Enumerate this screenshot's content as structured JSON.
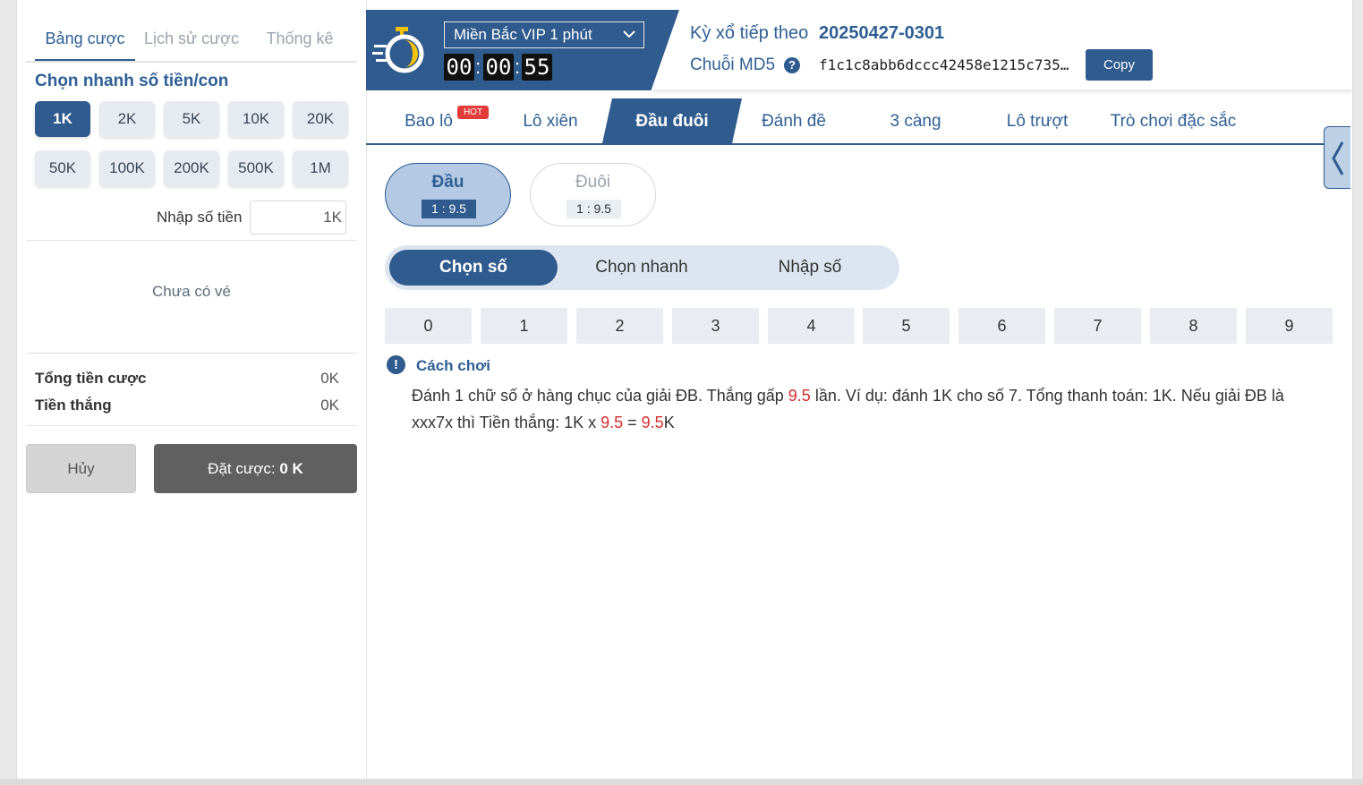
{
  "left_tabs": [
    {
      "label": "Bảng cược"
    },
    {
      "label": "Lịch sử cược"
    },
    {
      "label": "Thống kê"
    }
  ],
  "quick_amount": {
    "title": "Chọn nhanh số tiền/con",
    "chips": [
      "1K",
      "2K",
      "5K",
      "10K",
      "20K",
      "50K",
      "100K",
      "200K",
      "500K",
      "1M"
    ],
    "selected": "1K"
  },
  "amount_input": {
    "label": "Nhập số tiền",
    "value": "1K"
  },
  "ticket": {
    "empty_text": "Chưa có vé"
  },
  "summary": {
    "total_label": "Tổng tiền cược",
    "total_value": "0K",
    "win_label": "Tiền thắng",
    "win_value": "0K"
  },
  "actions": {
    "cancel": "Hủy",
    "bet_prefix": "Đặt cược:",
    "bet_amount": "0 K"
  },
  "header": {
    "game_select": "Miền Bắc VIP 1 phút",
    "timer": {
      "h": "00",
      "m": "00",
      "s": "55"
    },
    "next_draw_label": "Kỳ xổ tiếp theo",
    "next_draw_value": "20250427-0301",
    "md5_label": "Chuỗi MD5",
    "md5_help": "?",
    "md5_value": "f1c1c8abb6dccc42458e1215c735...",
    "copy_label": "Copy",
    "icon": "stopwatch-icon"
  },
  "game_tabs": [
    {
      "label": "Bao lô",
      "badge": "HOT"
    },
    {
      "label": "Lô xiên"
    },
    {
      "label": "Đầu đuôi",
      "active": true
    },
    {
      "label": "Đánh đề"
    },
    {
      "label": "3 càng"
    },
    {
      "label": "Lô trượt"
    },
    {
      "label": "Trò chơi đặc sắc"
    }
  ],
  "bet_types": [
    {
      "name": "Đầu",
      "ratio": "1 : 9.5",
      "active": true
    },
    {
      "name": "Đuôi",
      "ratio": "1 : 9.5",
      "active": false
    }
  ],
  "modes": [
    {
      "label": "Chọn số",
      "active": true
    },
    {
      "label": "Chọn nhanh"
    },
    {
      "label": "Nhập số"
    }
  ],
  "digits": [
    "0",
    "1",
    "2",
    "3",
    "4",
    "5",
    "6",
    "7",
    "8",
    "9"
  ],
  "howto": {
    "title": "Cách chơi",
    "icon": "!",
    "text_1": "Đánh 1 chữ số ở hàng chục của giải ĐB. Thắng gấp ",
    "mult_1": "9.5",
    "text_2": " lần. Ví dụ: đánh 1K cho số 7. Tổng thanh toán: 1K. Nếu giải ĐB là xxx7x thì Tiền thắng: 1K x ",
    "mult_2": "9.5",
    "text_3": " = ",
    "result": "9.5",
    "text_4": "K"
  },
  "colors": {
    "primary": "#2f5b8e",
    "accent_red": "#d32f2f",
    "hot_badge": "#e23b3b"
  }
}
